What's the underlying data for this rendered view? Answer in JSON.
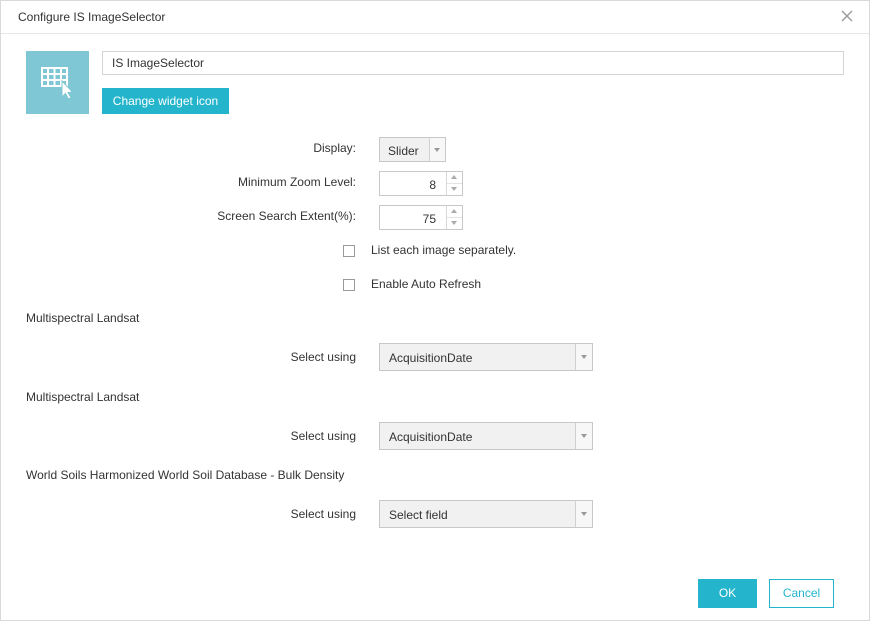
{
  "dialog": {
    "title": "Configure IS ImageSelector",
    "close_icon": "close-icon"
  },
  "widget": {
    "icon": "grid-cursor-icon",
    "name_value": "IS ImageSelector",
    "change_icon_label": "Change widget icon"
  },
  "settings": {
    "display_label": "Display:",
    "display_value": "Slider",
    "min_zoom_label": "Minimum Zoom Level:",
    "min_zoom_value": "8",
    "search_extent_label": "Screen Search Extent(%):",
    "search_extent_value": "75",
    "list_separately_label": "List each image separately.",
    "list_separately_checked": false,
    "auto_refresh_label": "Enable Auto Refresh",
    "auto_refresh_checked": false
  },
  "layers": [
    {
      "name": "Multispectral Landsat",
      "select_label": "Select using",
      "select_value": "AcquisitionDate"
    },
    {
      "name": "Multispectral Landsat",
      "select_label": "Select using",
      "select_value": "AcquisitionDate"
    },
    {
      "name": "World Soils Harmonized World Soil Database - Bulk Density",
      "select_label": "Select using",
      "select_value": "Select field"
    }
  ],
  "footer": {
    "ok_label": "OK",
    "cancel_label": "Cancel"
  },
  "colors": {
    "accent": "#24b5cc",
    "icon_bg": "#7fc7d4"
  }
}
